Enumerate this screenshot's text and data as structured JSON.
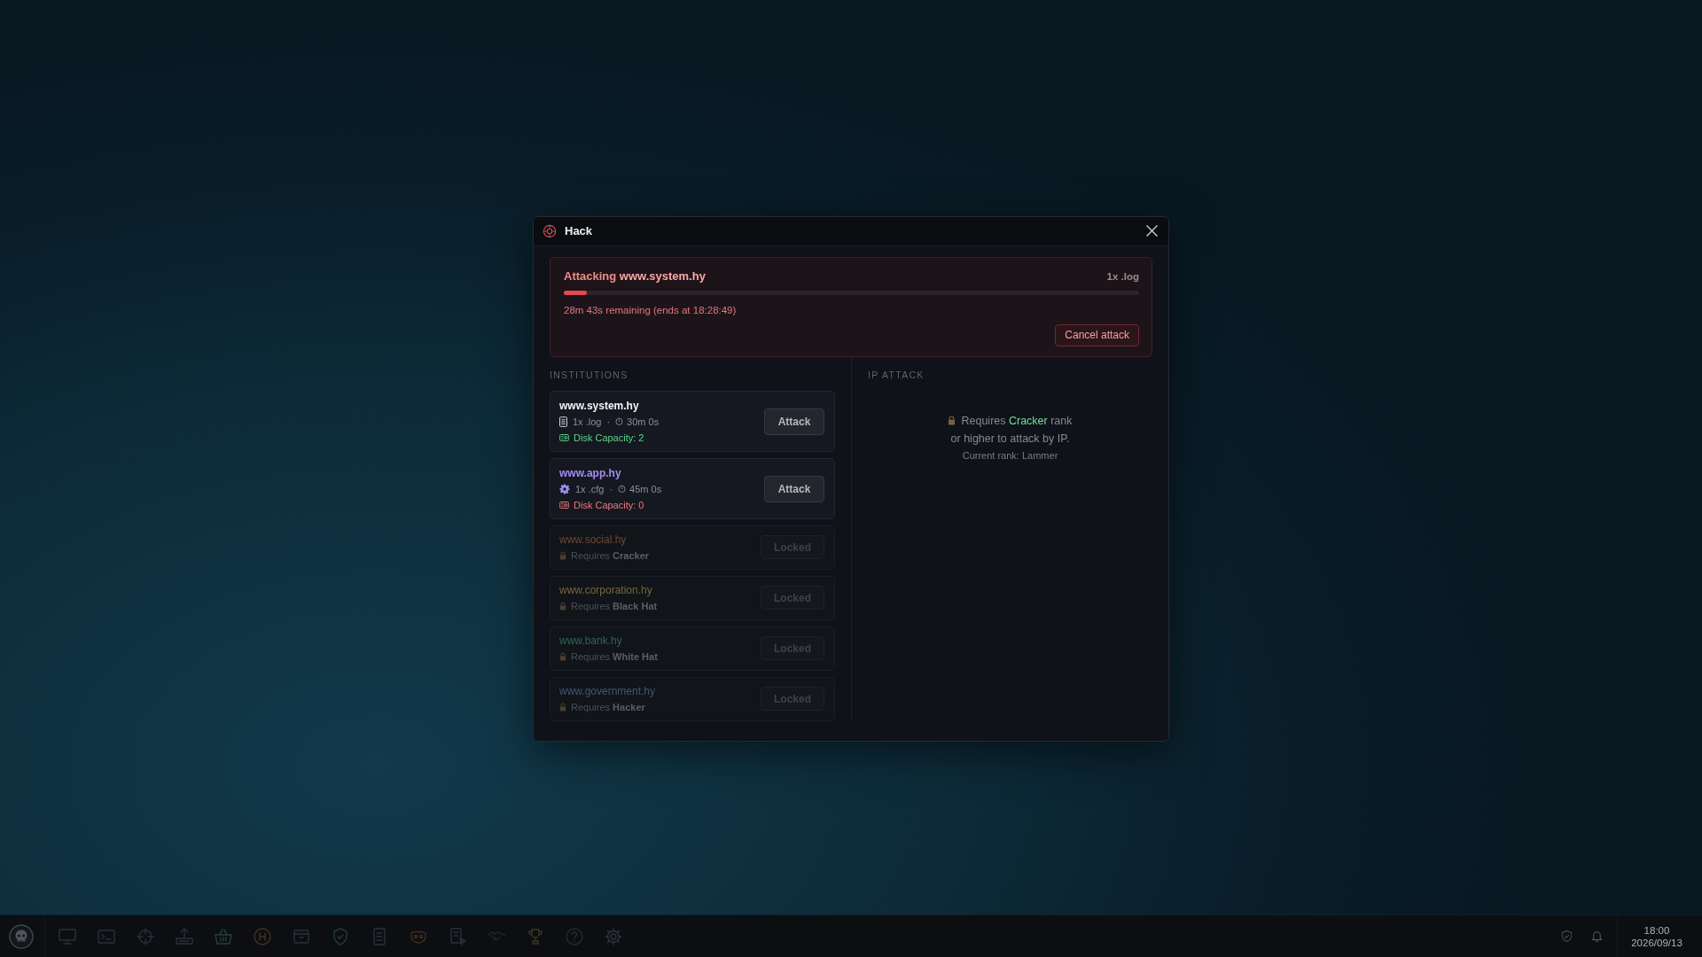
{
  "window": {
    "title": "Hack"
  },
  "attack": {
    "label": "Attacking **www.system.hy**",
    "payload": "1x .log",
    "level": 0.04,
    "remaining": "28m 43s remaining (ends at 18:28:49)",
    "cancel": "Cancel attack"
  },
  "institutions": {
    "heading": "INSTITUTIONS",
    "items": [
      {
        "domain": "www.system.hy",
        "color": "#f2f4f8",
        "locked": false,
        "file": {
          "kind": "document",
          "text": "1x .log"
        },
        "separator": "·",
        "duration": "30m 0s",
        "disk": {
          "text": "Disk Capacity: 2",
          "full": false
        },
        "action": "Attack"
      },
      {
        "domain": "www.app.hy",
        "color": "#a58cf0",
        "locked": false,
        "file": {
          "kind": "gear",
          "text": "1x .cfg"
        },
        "separator": "·",
        "duration": "45m 0s",
        "disk": {
          "text": "Disk Capacity: 0",
          "full": true
        },
        "action": "Attack"
      },
      {
        "domain": "www.social.hy",
        "color": "#6b4936",
        "locked": true,
        "requirement": "Requires **Cracker**",
        "action": "Locked"
      },
      {
        "domain": "www.corporation.hy",
        "color": "#75683a",
        "locked": true,
        "requirement": "Requires **Black Hat**",
        "action": "Locked"
      },
      {
        "domain": "www.bank.hy",
        "color": "#2f6656",
        "locked": true,
        "requirement": "Requires **White Hat**",
        "action": "Locked"
      },
      {
        "domain": "www.government.hy",
        "color": "#43567a",
        "locked": true,
        "requirement": "Requires **Hacker**",
        "action": "Locked"
      }
    ]
  },
  "ip_attack": {
    "heading": "IP ATTACK",
    "requirement": {
      "before": "Requires",
      "rank": "Cracker",
      "after": "rank",
      "continuation": "or higher to attack by IP."
    },
    "current_rank": "Current rank: Lammer"
  },
  "clock": {
    "time": "18:00",
    "date": "2026/09/13"
  }
}
